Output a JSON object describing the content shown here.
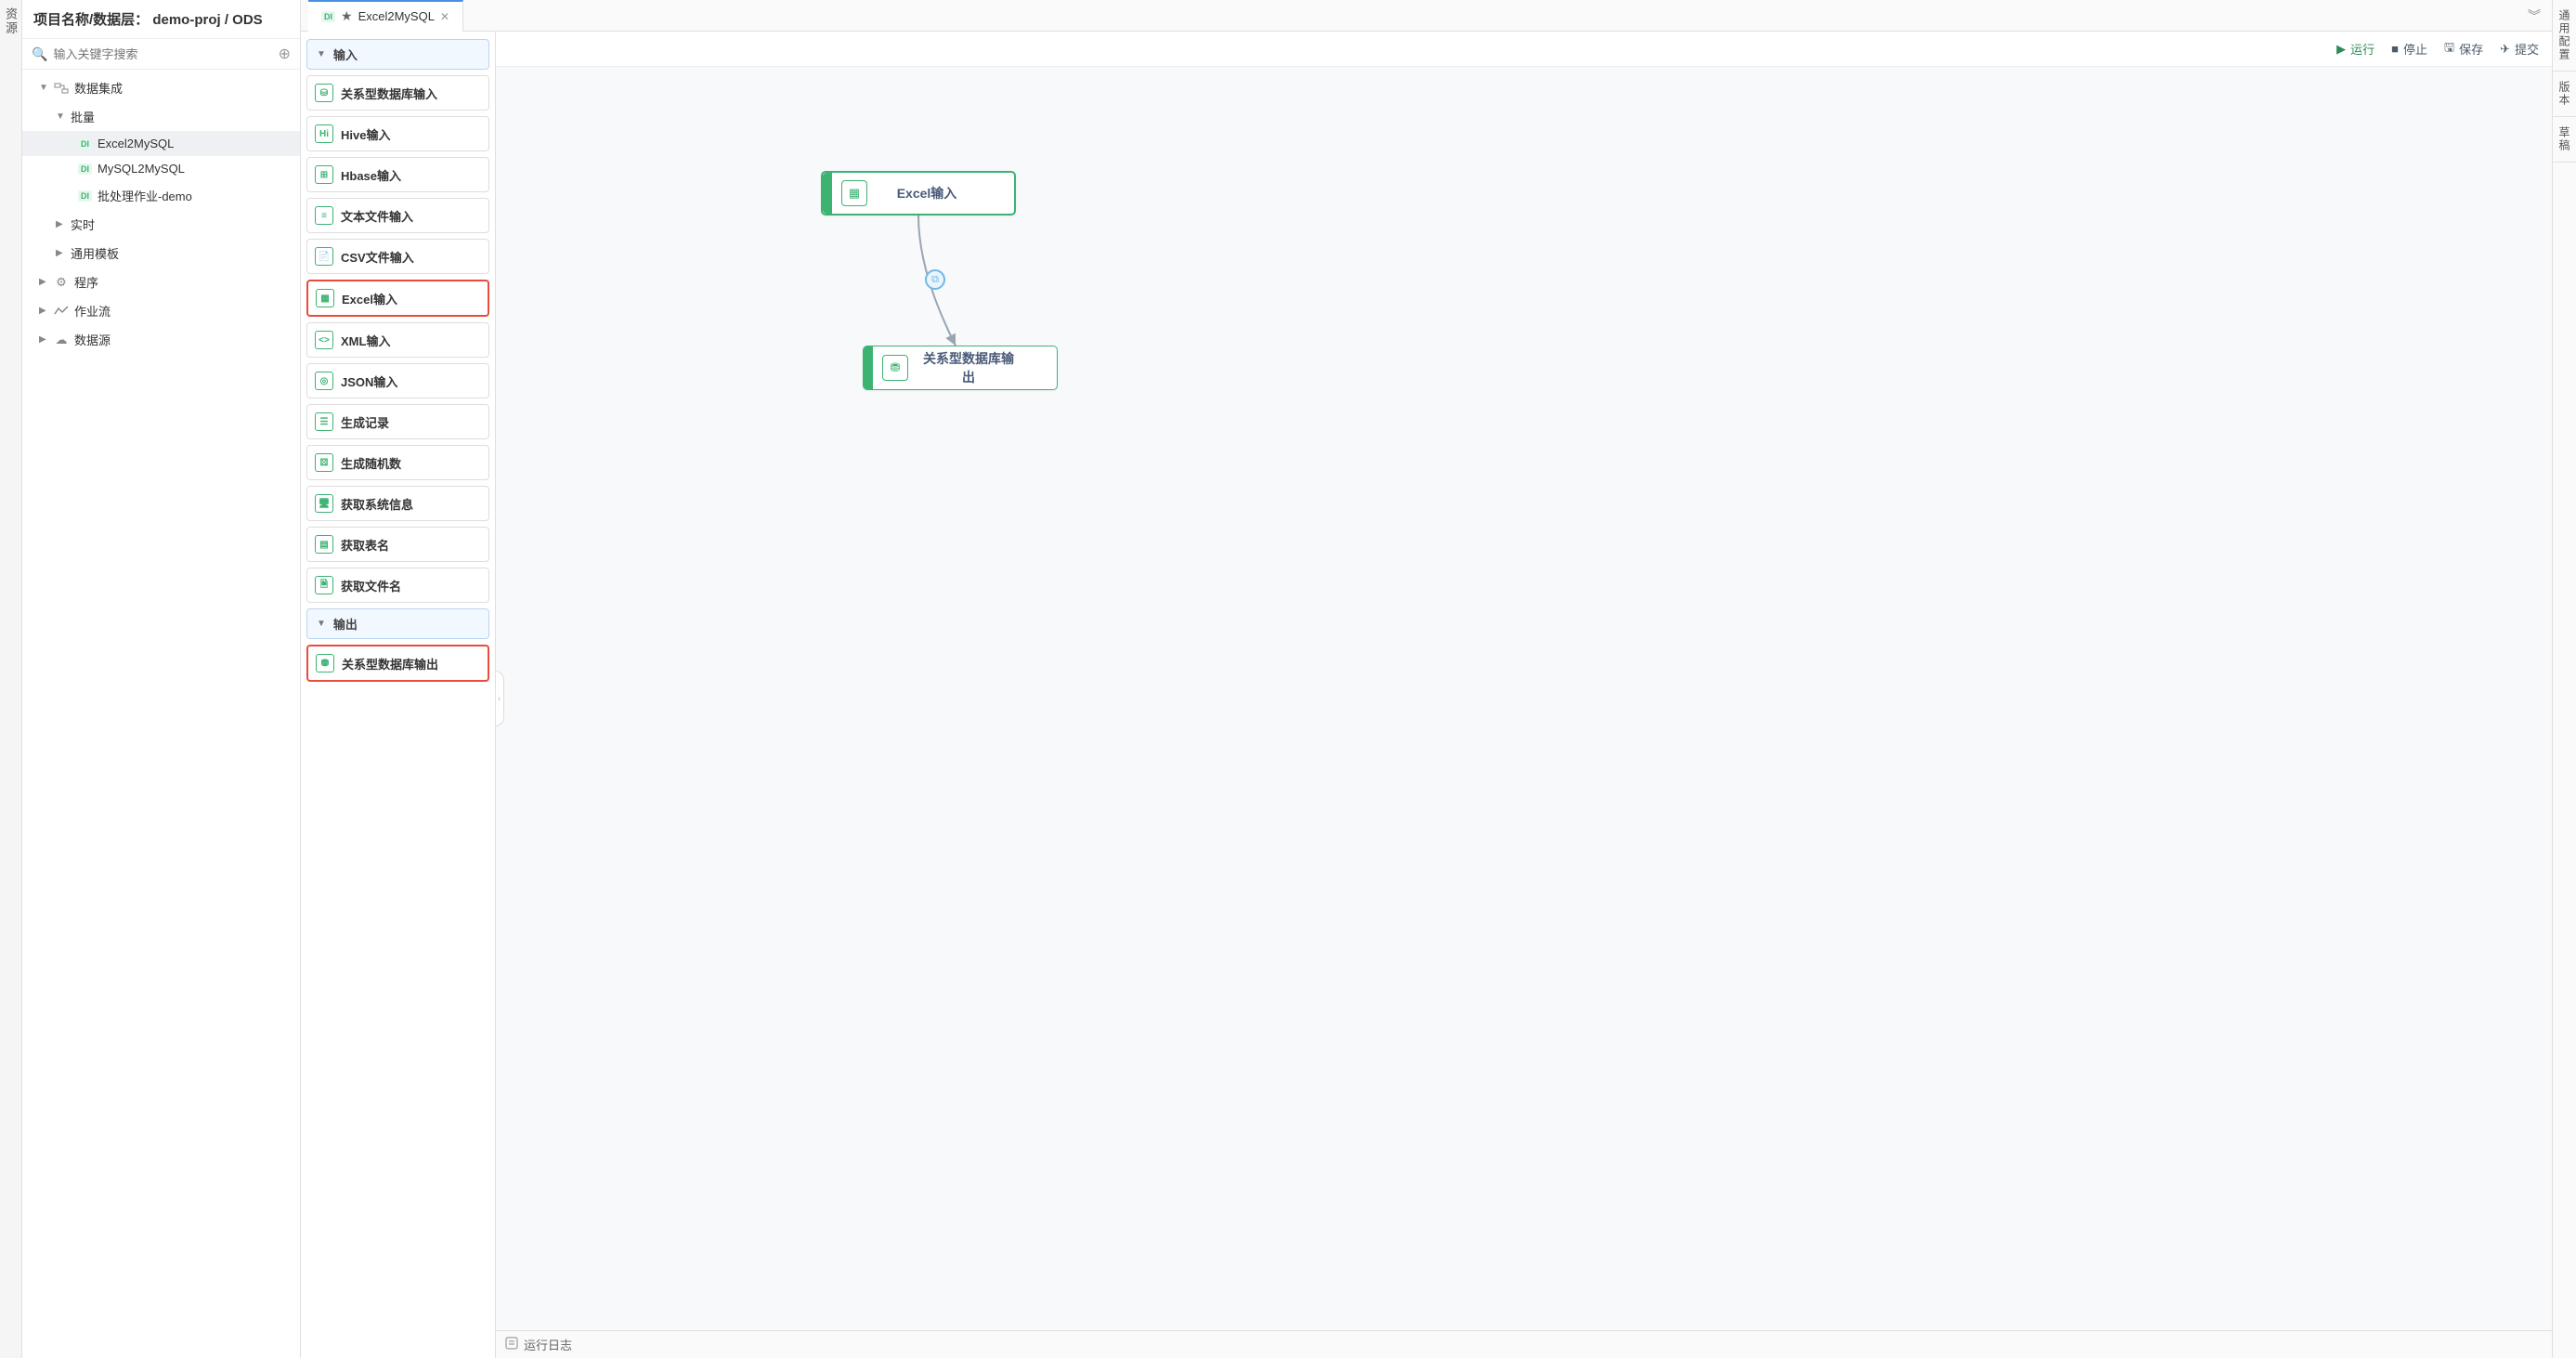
{
  "leftVTab": {
    "label": "资源"
  },
  "sidebar": {
    "headerLabel": "项目名称/数据层： demo-proj / ODS",
    "searchPlaceholder": "输入关键字搜索",
    "tree": {
      "dataIntegration": "数据集成",
      "batch": "批量",
      "items": [
        "Excel2MySQL",
        "MySQL2MySQL",
        "批处理作业-demo"
      ],
      "realtime": "实时",
      "template": "通用模板",
      "program": "程序",
      "workflow": "作业流",
      "datasource": "数据源"
    }
  },
  "tab": {
    "title": "Excel2MySQL",
    "dirty": "★"
  },
  "toolbar": {
    "run": "运行",
    "stop": "停止",
    "save": "保存",
    "submit": "提交"
  },
  "palette": {
    "inputGroup": "输入",
    "outputGroup": "输出",
    "inputs": [
      "关系型数据库输入",
      "Hive输入",
      "Hbase输入",
      "文本文件输入",
      "CSV文件输入",
      "Excel输入",
      "XML输入",
      "JSON输入",
      "生成记录",
      "生成随机数",
      "获取系统信息",
      "获取表名",
      "获取文件名"
    ],
    "outputs": [
      "关系型数据库输出"
    ]
  },
  "canvas": {
    "node1": "Excel输入",
    "node2": "关系型数据库输出"
  },
  "bottomBar": {
    "label": "运行日志"
  },
  "rightTabs": {
    "config": "通用配置",
    "version": "版本",
    "draft": "草稿"
  }
}
